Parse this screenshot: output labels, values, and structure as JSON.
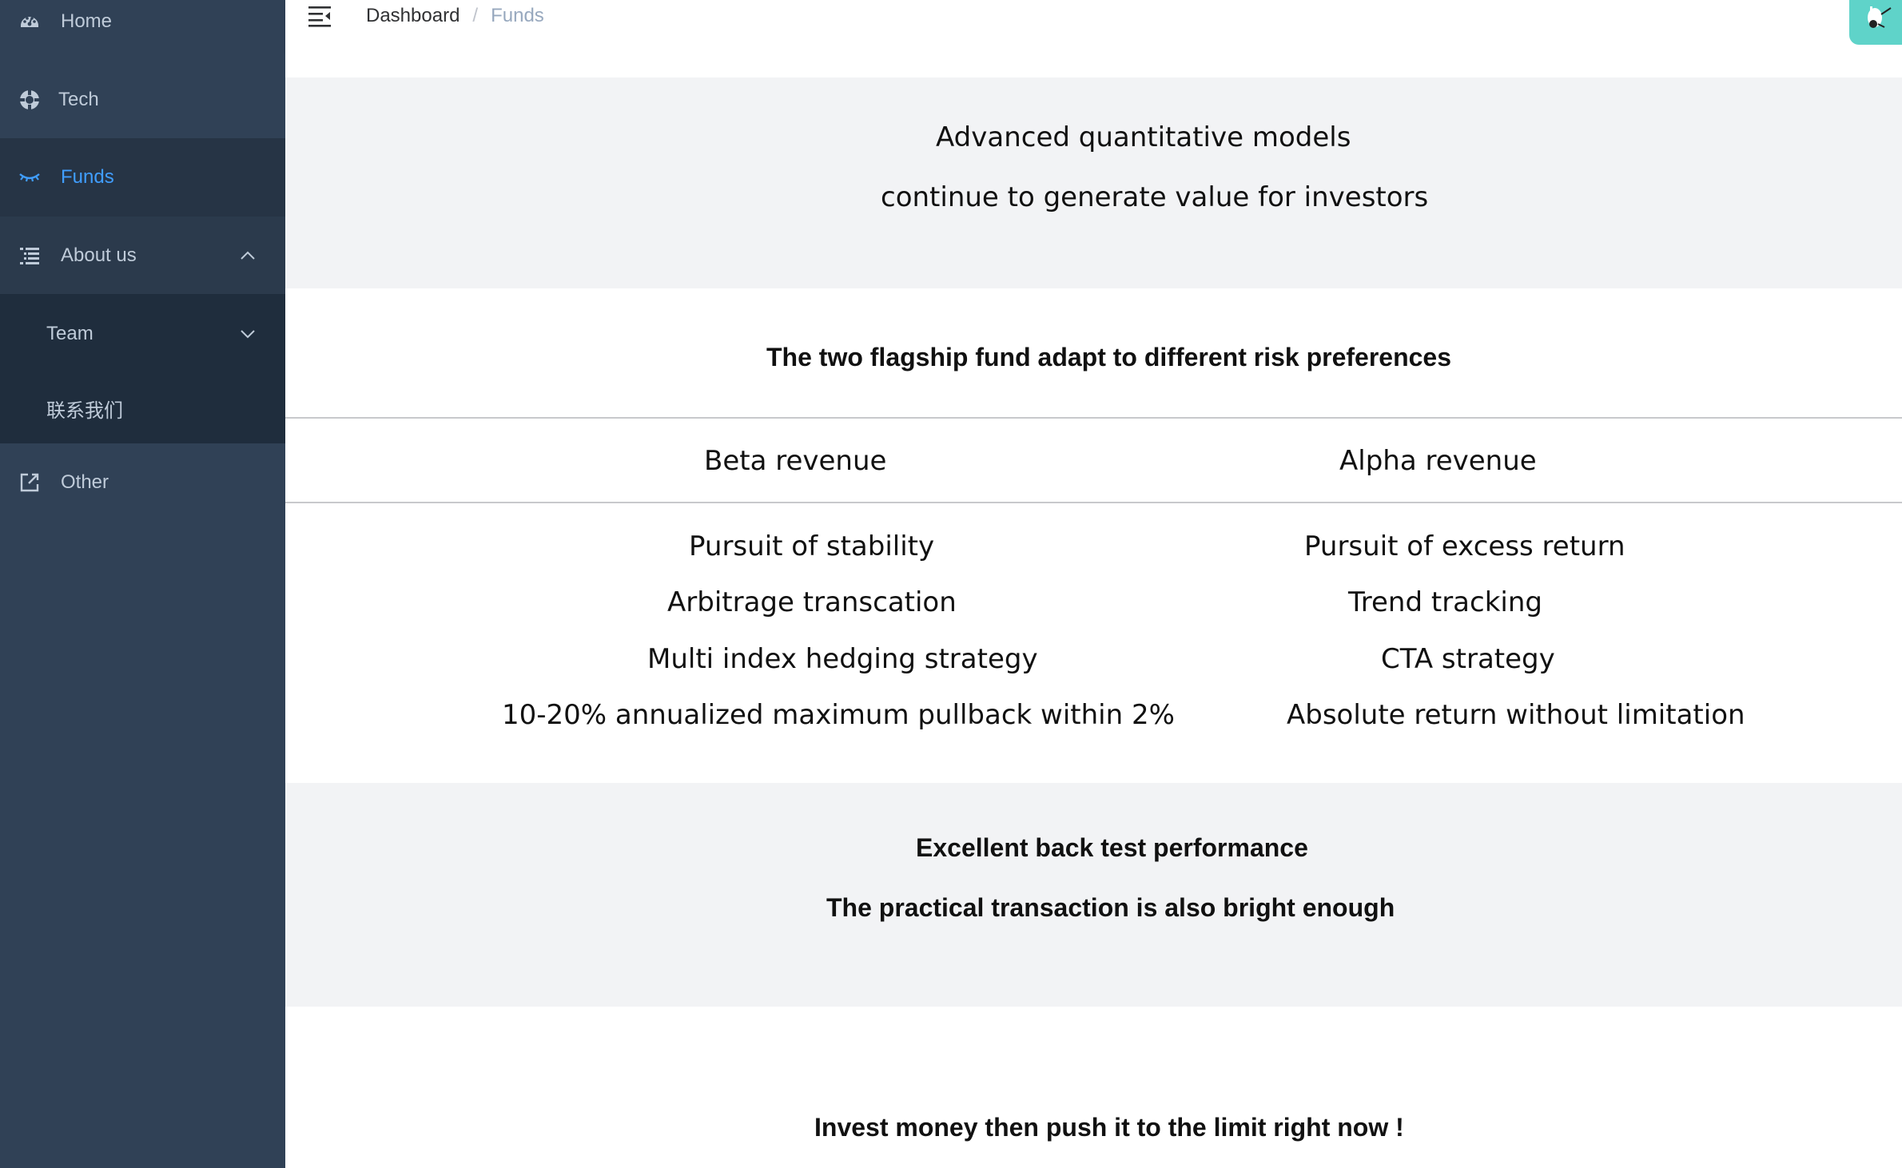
{
  "sidebar": {
    "items": [
      {
        "label": "Home",
        "icon": "dashboard-icon"
      },
      {
        "label": "Tech",
        "icon": "lifebuoy-icon"
      },
      {
        "label": "Funds",
        "icon": "eye-closed-icon",
        "active": true
      },
      {
        "label": "About us",
        "icon": "list-tree-icon",
        "expanded": true,
        "children": [
          {
            "label": "Team",
            "expandable": true
          },
          {
            "label": "联系我们"
          }
        ]
      },
      {
        "label": "Other",
        "icon": "external-link-icon"
      }
    ],
    "active_color": "#409eff",
    "background": "#304156"
  },
  "header": {
    "breadcrumb": [
      {
        "label": "Dashboard"
      },
      {
        "label": "Funds"
      }
    ],
    "separator": "/"
  },
  "main": {
    "hero": {
      "line1": "Advanced quantitative models",
      "line2": "continue to generate value for investors"
    },
    "flagship": {
      "title": "The two flagship fund adapt to different risk preferences",
      "columns": [
        "Beta revenue",
        "Alpha revenue"
      ],
      "rows": [
        [
          "Pursuit of stability",
          "Pursuit of excess return"
        ],
        [
          "Arbitrage transcation",
          "Trend tracking"
        ],
        [
          "Multi index hedging strategy",
          "CTA strategy"
        ],
        [
          "10-20% annualized maximum pullback within 2%",
          "Absolute return without limitation"
        ]
      ]
    },
    "backtest": {
      "line1": "Excellent back test performance",
      "line2": "The practical transaction is also bright enough"
    },
    "cta": {
      "text": "Invest money then push it to the limit right now !"
    }
  }
}
